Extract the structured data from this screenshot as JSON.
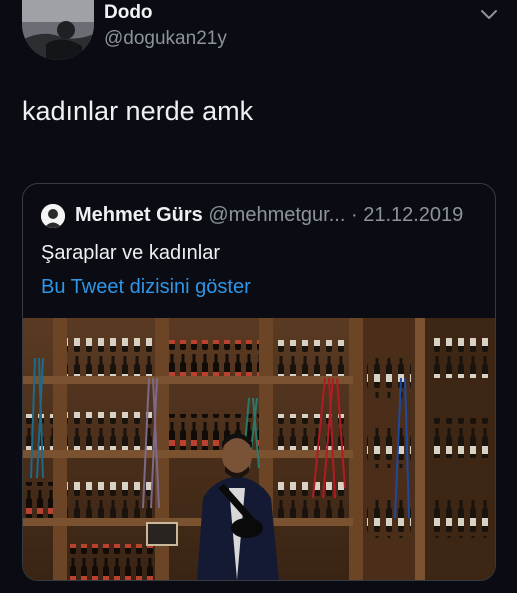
{
  "tweet": {
    "author_name": "Dodo",
    "author_handle": "@dogukan21y",
    "text": "kadınlar nerde amk"
  },
  "quoted_tweet": {
    "author_name": "Mehmet Gürs",
    "author_handle": "@mehmetgur...",
    "separator": "·",
    "date": "21.12.2019",
    "text": "Şaraplar ve kadınlar",
    "thread_link": "Bu Tweet dizisini göster"
  },
  "icons": {
    "menu": "chevron-down-icon"
  },
  "colors": {
    "background": "#0b0c13",
    "link": "#2f95e6",
    "secondary_text": "#8b939b",
    "border": "#363b42"
  }
}
